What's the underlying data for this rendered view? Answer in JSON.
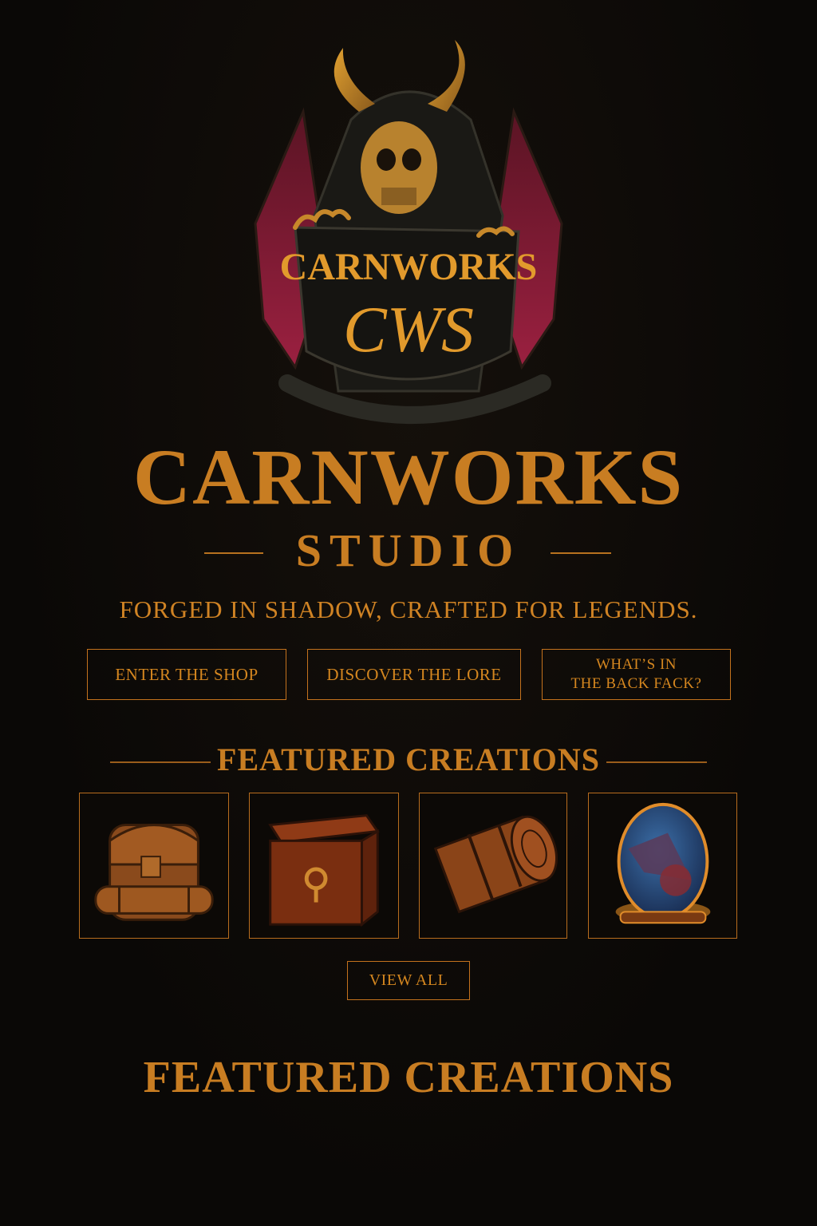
{
  "logo": {
    "wordmark": "CARNWORKS",
    "monogram": "CWS"
  },
  "brand": {
    "title": "CARNWORKS",
    "subtitle": "STUDIO",
    "tagline": "FORGED IN SHADOW, CRAFTED FOR LEGENDS."
  },
  "nav": {
    "shop_label": "ENTER THE SHOP",
    "lore_label": "DISCOVER THE LORE",
    "backpack_line1": "WHAT’S IN",
    "backpack_line2": "THE BACK FACK?"
  },
  "featured": {
    "heading": "FEATURED CREATIONS",
    "items": [
      {
        "icon": "backpack-icon"
      },
      {
        "icon": "leather-box-icon"
      },
      {
        "icon": "bedroll-icon"
      },
      {
        "icon": "dragon-egg-icon"
      }
    ],
    "view_all_label": "VIEW ALL"
  },
  "footer_section": {
    "heading": "FEATURED CREATIONS"
  },
  "colors": {
    "background": "#0a0806",
    "accent": "#c87d22",
    "wing": "#8c1f3a",
    "border": "#c4721d"
  }
}
